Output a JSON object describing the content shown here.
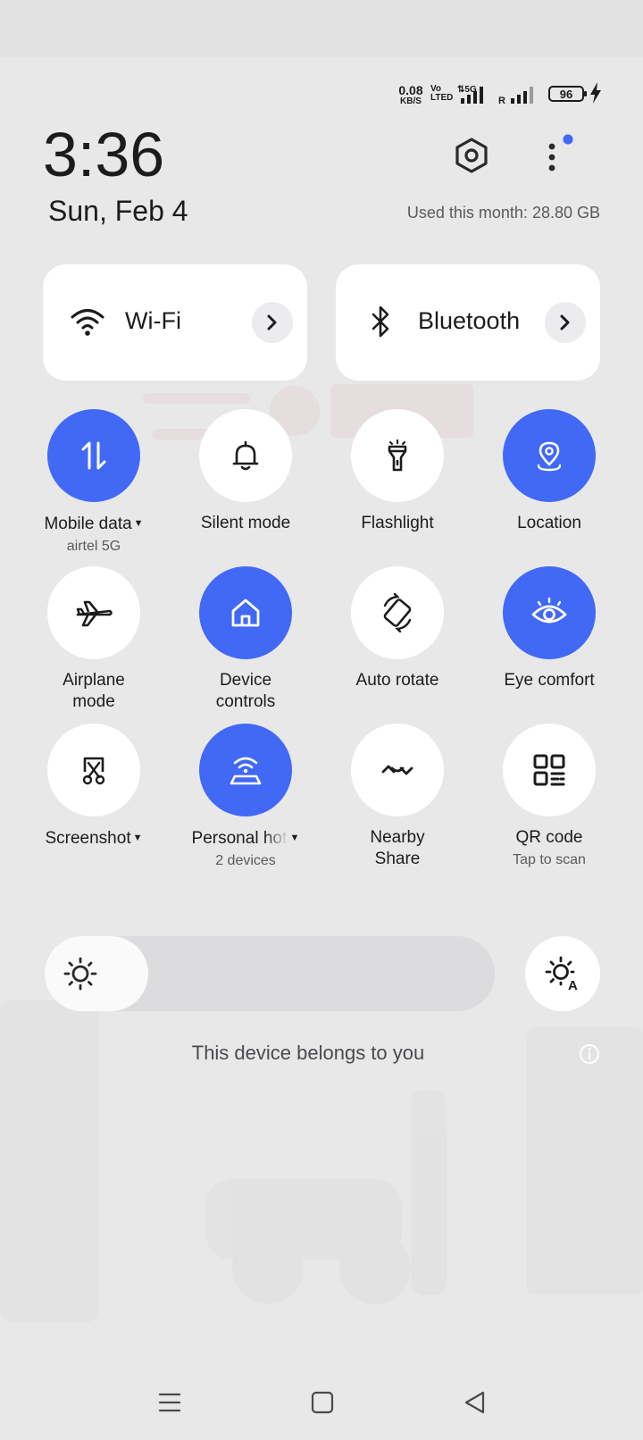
{
  "status_bar": {
    "net_speed": "0.08",
    "net_speed_unit": "KB/S",
    "volte_label": "Vo LTED",
    "network_type": "5G",
    "roaming_indicator": "R",
    "battery_percent": "96",
    "charging": true
  },
  "header": {
    "time": "3:36",
    "date": "Sun, Feb 4",
    "data_usage": "Used this month: 28.80 GB",
    "settings_icon": "settings-gear-icon",
    "more_icon": "more-vertical-icon",
    "accent_color": "#4169f6"
  },
  "big_tiles": [
    {
      "label": "Wi-Fi",
      "icon": "wifi-icon"
    },
    {
      "label": "Bluetooth",
      "icon": "bluetooth-icon"
    }
  ],
  "toggles": [
    {
      "label": "Mobile data",
      "sub": "airtel 5G",
      "on": true,
      "dropdown": true,
      "icon": "mobile-data-icon"
    },
    {
      "label": "Silent mode",
      "sub": "",
      "on": false,
      "icon": "bell-icon"
    },
    {
      "label": "Flashlight",
      "sub": "",
      "on": false,
      "icon": "flashlight-icon"
    },
    {
      "label": "Location",
      "sub": "",
      "on": true,
      "icon": "location-icon"
    },
    {
      "label": "Airplane",
      "label2": "mode",
      "on": false,
      "icon": "airplane-icon"
    },
    {
      "label": "Device",
      "label2": "controls",
      "on": true,
      "icon": "home-icon"
    },
    {
      "label": "Auto rotate",
      "sub": "",
      "on": false,
      "icon": "auto-rotate-icon"
    },
    {
      "label": "Eye comfort",
      "sub": "",
      "on": true,
      "icon": "eye-icon"
    },
    {
      "label": "Screenshot",
      "sub": "",
      "on": false,
      "dropdown": true,
      "icon": "screenshot-icon"
    },
    {
      "label": "Personal hotspot",
      "sub": "2 devices",
      "on": true,
      "dropdown": true,
      "icon": "hotspot-icon"
    },
    {
      "label": "Nearby",
      "label2": "Share",
      "on": false,
      "icon": "nearby-share-icon"
    },
    {
      "label": "QR code",
      "sub": "Tap to scan",
      "on": false,
      "icon": "qr-code-icon"
    }
  ],
  "brightness": {
    "level": 0.23,
    "icon": "brightness-icon",
    "auto_icon": "auto-brightness-icon"
  },
  "footer": {
    "owner_text": "This device belongs to you",
    "info_icon": "info-icon"
  },
  "nav_bar": {
    "menu_icon": "menu-icon",
    "home_icon": "home-square-icon",
    "back_icon": "back-triangle-icon"
  }
}
